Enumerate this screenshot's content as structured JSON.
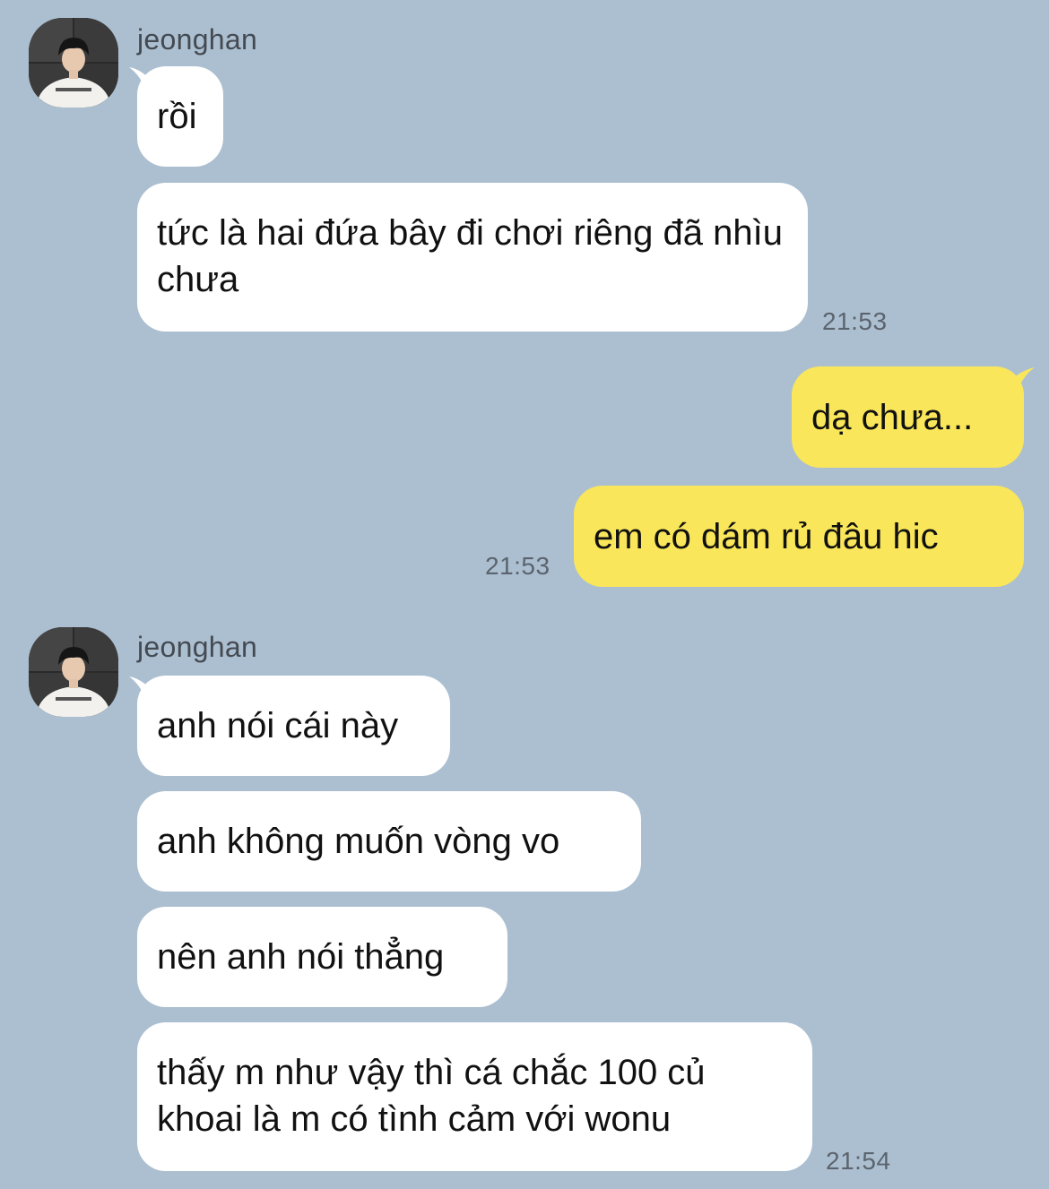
{
  "thread": {
    "group1": {
      "sender_name": "jeonghan",
      "avatar_icon": "profile-photo",
      "messages": [
        "rồi",
        "tức là hai đứa bây đi chơi riêng đã nhìu chưa"
      ],
      "time": "21:53"
    },
    "mine": {
      "messages": [
        "dạ chưa...",
        "em có dám rủ đâu hic"
      ],
      "time": "21:53"
    },
    "group2": {
      "sender_name": "jeonghan",
      "avatar_icon": "profile-photo",
      "messages": [
        "anh nói cái này",
        "anh không muốn vòng vo",
        "nên anh nói thẳng",
        "thấy m như vậy thì cá chắc 100 củ khoai là m có tình cảm với wonu"
      ],
      "time": "21:54"
    }
  },
  "colors": {
    "background": "#acbfd0",
    "incoming_bubble": "#ffffff",
    "outgoing_bubble": "#f9e65a",
    "text": "#111111",
    "meta_text": "#5b646e"
  }
}
